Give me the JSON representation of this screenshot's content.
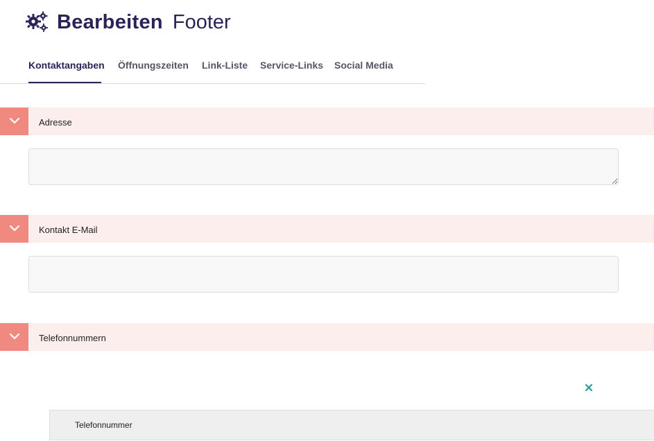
{
  "header": {
    "title_strong": "Bearbeiten",
    "title_light": "Footer",
    "icon": "gears-icon"
  },
  "tabs": [
    {
      "label": "Kontaktangaben",
      "active": true
    },
    {
      "label": "Öffnungszeiten",
      "active": false
    },
    {
      "label": "Link-Liste",
      "active": false
    },
    {
      "label": "Service-Links",
      "active": false
    },
    {
      "label": "Social Media",
      "active": false
    }
  ],
  "sections": [
    {
      "label": "Adresse",
      "field_value": "",
      "icon": "chevron-down-icon"
    },
    {
      "label": "Kontakt E-Mail",
      "field_value": "",
      "icon": "chevron-down-icon"
    },
    {
      "label": "Telefonnummern",
      "icon": "chevron-down-icon"
    }
  ],
  "phone_entry": {
    "label": "Telefonnummer",
    "remove_icon": "close-icon"
  },
  "colors": {
    "brand": "#2d2258",
    "section_bg": "#fdeeee",
    "toggle_bg": "#f08a80",
    "remove_icon": "#2a9a9a"
  }
}
